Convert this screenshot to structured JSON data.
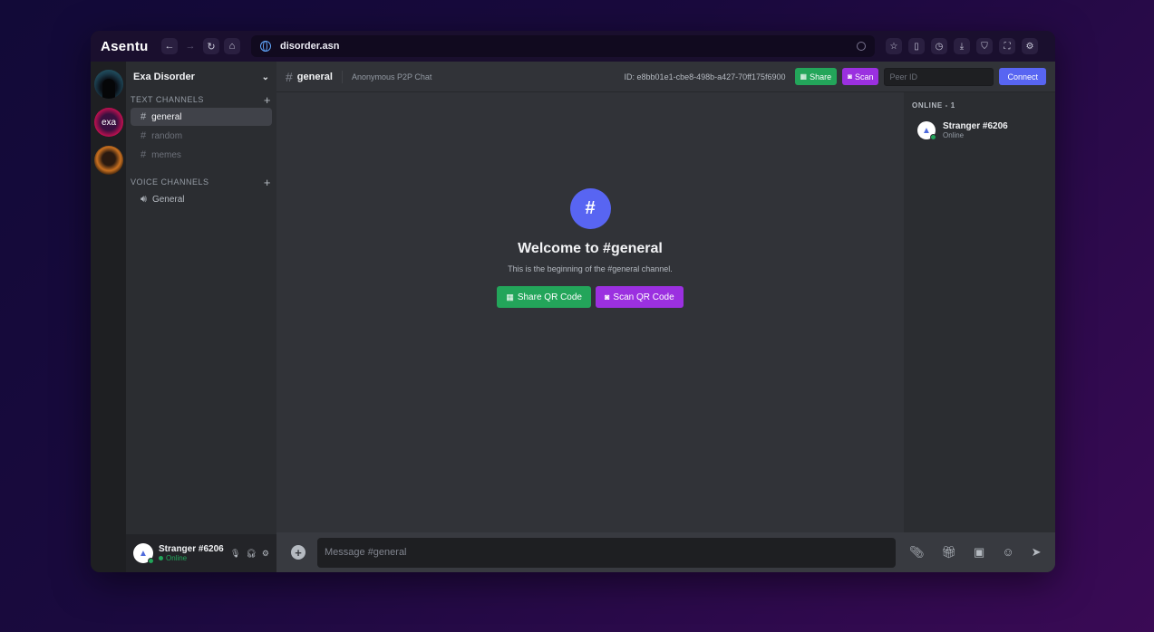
{
  "browser": {
    "brand": "Asentu",
    "url": "disorder.asn",
    "nav": [
      "back-icon",
      "forward-icon",
      "reload-icon",
      "home-icon"
    ],
    "tools": [
      "star-icon",
      "reader-icon",
      "history-icon",
      "download-icon",
      "shield-icon",
      "fullscreen-icon",
      "settings-icon"
    ]
  },
  "servers": [
    {
      "name": "server-1"
    },
    {
      "label": "exa"
    },
    {
      "name": "server-3"
    }
  ],
  "sidebar": {
    "server_name": "Exa Disorder",
    "text_category": "TEXT CHANNELS",
    "text_channels": [
      "general",
      "random",
      "memes"
    ],
    "voice_category": "VOICE CHANNELS",
    "voice_channels": [
      "General"
    ]
  },
  "user_panel": {
    "name": "Stranger #6206",
    "status": "Online"
  },
  "topbar": {
    "channel": "general",
    "topic": "Anonymous P2P Chat",
    "peer_id": "ID: e8bb01e1-cbe8-498b-a427-70ff175f6900",
    "share_label": "Share",
    "scan_label": "Scan",
    "peer_placeholder": "Peer ID",
    "connect_label": "Connect"
  },
  "welcome": {
    "title": "Welcome to #general",
    "subtitle": "This is the beginning of the #general channel.",
    "share_qr": "Share QR Code",
    "scan_qr": "Scan QR Code"
  },
  "members": {
    "header": "ONLINE - 1",
    "list": [
      {
        "name": "Stranger #6206",
        "status": "Online"
      }
    ]
  },
  "composer": {
    "placeholder": "Message #general"
  },
  "colors": {
    "accent": "#5865f2",
    "green": "#23a55a",
    "purple": "#9b30e0"
  }
}
